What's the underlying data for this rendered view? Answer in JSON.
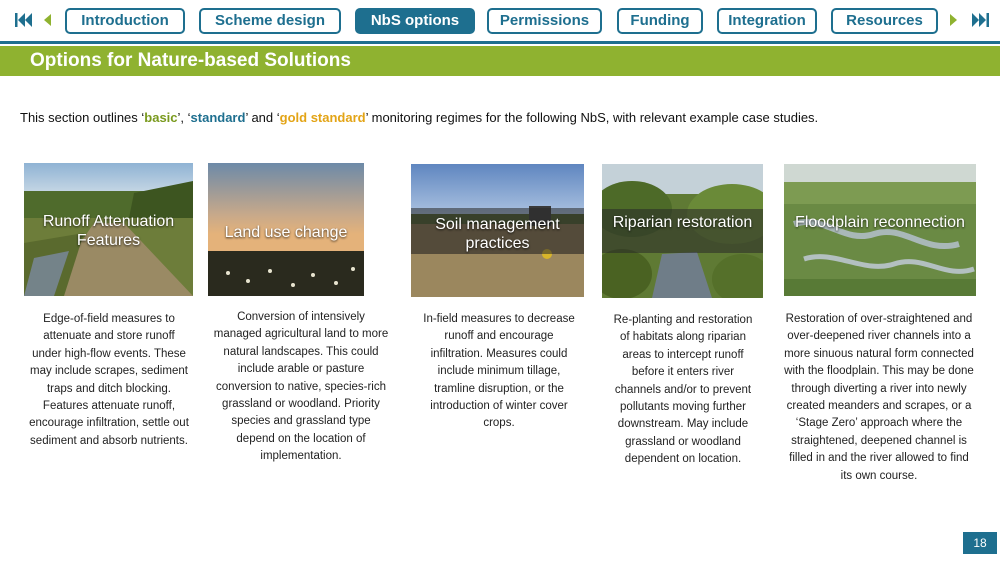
{
  "nav": {
    "first_icon": "skip-to-first-icon",
    "prev_icon": "previous-icon",
    "next_icon": "next-icon",
    "last_icon": "skip-to-last-icon",
    "tabs": [
      {
        "label": "Introduction",
        "active": false
      },
      {
        "label": "Scheme design",
        "active": false
      },
      {
        "label": "NbS options",
        "active": true
      },
      {
        "label": "Permissions",
        "active": false
      },
      {
        "label": "Funding",
        "active": false
      },
      {
        "label": "Integration",
        "active": false
      },
      {
        "label": "Resources",
        "active": false
      }
    ]
  },
  "banner": {
    "title": "Options for Nature-based Solutions"
  },
  "intro": {
    "p1": "This section outlines ‘",
    "basic": "basic",
    "p2": "’, ‘",
    "standard": "standard",
    "p3": "’ and ‘",
    "gold": "gold standard",
    "p4": "’ monitoring regimes for the following NbS, with relevant example case studies."
  },
  "cards": [
    {
      "title": "Runoff Attenuation Features",
      "description": "Edge-of-field measures to attenuate and store runoff under high-flow events. These may include scrapes, sediment traps and ditch blocking. Features attenuate runoff, encourage infiltration, settle out sediment and absorb nutrients."
    },
    {
      "title": "Land use change",
      "description": "Conversion of intensively managed agricultural land to more natural landscapes. This could include arable or pasture conversion to native, species-rich grassland or woodland. Priority species and grassland type depend on the location of implementation."
    },
    {
      "title": "Soil management practices",
      "description": "In-field measures to decrease runoff and encourage infiltration. Measures could include minimum tillage, tramline disruption, or the introduction of winter cover crops."
    },
    {
      "title": "Riparian restoration",
      "description": "Re-planting and restoration of habitats along riparian areas to intercept runoff before it enters river channels and/or to prevent pollutants moving further downstream. May include grassland or woodland dependent on location."
    },
    {
      "title": "Floodplain reconnection",
      "description": "Restoration of over-straightened and over-deepened river channels into a more sinuous natural form connected with the floodplain. This may be done through diverting a river into newly created meanders and scrapes, or a ‘Stage Zero’ approach where the straightened, deepened channel is filled in and the river allowed to find its own course."
    }
  ],
  "page_number": "18",
  "colors": {
    "nav_blue": "#1e6f8f",
    "banner_green": "#8fb230",
    "basic_green": "#7a9a1e",
    "gold": "#e3a416"
  }
}
